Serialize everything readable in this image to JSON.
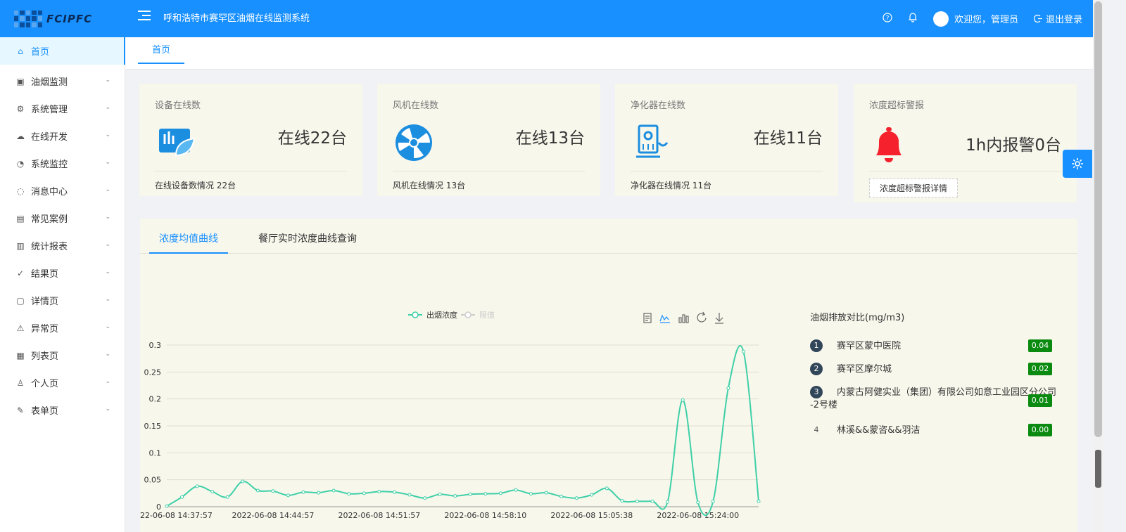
{
  "header": {
    "logo_text": "FCIPFC",
    "system_title": "呼和浩特市赛罕区油烟在线监测系统",
    "welcome": "欢迎您，管理员",
    "logout": "退出登录"
  },
  "sidebar": {
    "items": [
      {
        "label": "首页",
        "icon": "home-icon"
      },
      {
        "label": "油烟监测",
        "icon": "monitor-icon"
      },
      {
        "label": "系统管理",
        "icon": "settings-icon"
      },
      {
        "label": "在线开发",
        "icon": "cloud-icon"
      },
      {
        "label": "系统监控",
        "icon": "dashboard-icon"
      },
      {
        "label": "消息中心",
        "icon": "message-icon"
      },
      {
        "label": "常见案例",
        "icon": "case-icon"
      },
      {
        "label": "统计报表",
        "icon": "bar-chart-icon"
      },
      {
        "label": "结果页",
        "icon": "check-circle-icon"
      },
      {
        "label": "详情页",
        "icon": "profile-icon"
      },
      {
        "label": "异常页",
        "icon": "warning-icon"
      },
      {
        "label": "列表页",
        "icon": "table-icon"
      },
      {
        "label": "个人页",
        "icon": "user-icon"
      },
      {
        "label": "表单页",
        "icon": "form-icon"
      }
    ]
  },
  "tabs": {
    "home": "首页"
  },
  "cards": {
    "devices": {
      "title": "设备在线数",
      "value": "在线22台",
      "footer": "在线设备数情况 22台"
    },
    "fans": {
      "title": "风机在线数",
      "value": "在线13台",
      "footer": "风机在线情况 13台"
    },
    "purifiers": {
      "title": "净化器在线数",
      "value": "在线11台",
      "footer": "净化器在线情况 11台"
    },
    "alarm": {
      "title": "浓度超标警报",
      "value": "1h内报警0台",
      "button": "浓度超标警报详情"
    }
  },
  "panel": {
    "tab_avg": "浓度均值曲线",
    "tab_realtime": "餐厅实时浓度曲线查询"
  },
  "ranking": {
    "title": "油烟排放对比(mg/m3)",
    "items": [
      {
        "no": "1",
        "name": "赛罕区蒙中医院",
        "value": "0.04"
      },
      {
        "no": "2",
        "name": "赛罕区摩尔城",
        "value": "0.02"
      },
      {
        "no": "3",
        "name": "内蒙古阿健实业（集团）有限公司如意工业园区分公司 -2号楼",
        "value": "0.01"
      },
      {
        "no": "4",
        "name": "林溪&&蒙咨&&羽洁",
        "value": "0.00"
      }
    ]
  },
  "colors": {
    "primary": "#1890ff",
    "line": "#3fd0a8",
    "badge": "#0a8a10",
    "alarm": "#f5222d"
  },
  "chart_data": {
    "type": "line",
    "legend": [
      "出烟浓度",
      "限值"
    ],
    "ylim": [
      0,
      0.3
    ],
    "yticks": [
      "0",
      "0.05",
      "0.1",
      "0.15",
      "0.2",
      "0.25",
      "0.3"
    ],
    "xticks": [
      "22-06-08 14:37:57",
      "2022-06-08 14:44:57",
      "2022-06-08 14:51:57",
      "2022-06-08 14:58:10",
      "2022-06-08 15:05:38",
      "2022-06-08 15:24:00"
    ],
    "series": [
      {
        "name": "出烟浓度",
        "values": [
          0.001,
          0.018,
          0.038,
          0.028,
          0.018,
          0.047,
          0.03,
          0.029,
          0.021,
          0.027,
          0.026,
          0.03,
          0.024,
          0.025,
          0.028,
          0.027,
          0.022,
          0.016,
          0.023,
          0.02,
          0.023,
          0.024,
          0.025,
          0.031,
          0.024,
          0.026,
          0.019,
          0.016,
          0.022,
          0.034,
          0.011,
          0.01,
          0.01,
          0.009,
          0.198,
          0.008,
          0.01,
          0.22,
          0.288,
          0.01
        ]
      }
    ]
  }
}
